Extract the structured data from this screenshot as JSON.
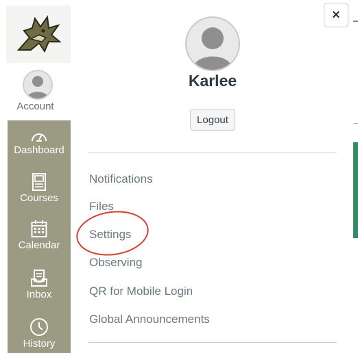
{
  "global_nav": {
    "account_label": "Account",
    "items": [
      {
        "label": "Dashboard",
        "icon": "dashboard-icon"
      },
      {
        "label": "Courses",
        "icon": "courses-icon"
      },
      {
        "label": "Calendar",
        "icon": "calendar-icon"
      },
      {
        "label": "Inbox",
        "icon": "inbox-icon"
      },
      {
        "label": "History",
        "icon": "history-icon"
      }
    ]
  },
  "tray": {
    "close_label": "×",
    "user_name": "Karlee",
    "logout_label": "Logout",
    "links": [
      {
        "label": "Notifications"
      },
      {
        "label": "Files"
      },
      {
        "label": "Settings"
      },
      {
        "label": "Observing"
      },
      {
        "label": "QR for Mobile Login"
      },
      {
        "label": "Global Announcements"
      }
    ]
  },
  "colors": {
    "nav_bg": "#9b9a82",
    "annotation": "#d1402f",
    "link_text": "#6b7780",
    "heading": "#2d3b45"
  }
}
